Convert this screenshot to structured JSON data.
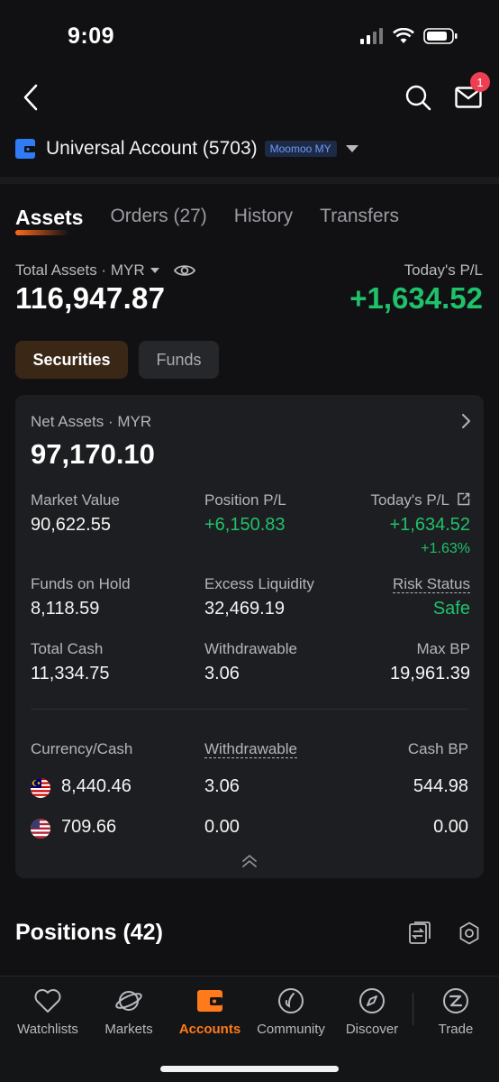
{
  "status": {
    "time": "9:09"
  },
  "nav": {
    "mail_badge": "1"
  },
  "account": {
    "name": "Universal Account (5703)",
    "broker": "Moomoo MY"
  },
  "tabs": [
    {
      "label": "Assets",
      "active": true
    },
    {
      "label": "Orders (27)",
      "active": false
    },
    {
      "label": "History",
      "active": false
    },
    {
      "label": "Transfers",
      "active": false
    }
  ],
  "totals": {
    "label": "Total Assets · MYR",
    "value": "116,947.87",
    "todays_pl_label": "Today's P/L",
    "todays_pl_value": "+1,634.52"
  },
  "segments": {
    "securities": "Securities",
    "funds": "Funds"
  },
  "card": {
    "net_assets_label": "Net Assets · MYR",
    "net_assets_value": "97,170.10",
    "market_value_label": "Market Value",
    "market_value": "90,622.55",
    "position_pl_label": "Position P/L",
    "position_pl": "+6,150.83",
    "todays_pl_label": "Today's P/L",
    "todays_pl": "+1,634.52",
    "todays_pl_pct": "+1.63%",
    "funds_on_hold_label": "Funds on Hold",
    "funds_on_hold": "8,118.59",
    "excess_liquidity_label": "Excess Liquidity",
    "excess_liquidity": "32,469.19",
    "risk_status_label": "Risk Status",
    "risk_status": "Safe",
    "total_cash_label": "Total Cash",
    "total_cash": "11,334.75",
    "withdrawable_label": "Withdrawable",
    "withdrawable": "3.06",
    "max_bp_label": "Max BP",
    "max_bp": "19,961.39",
    "currency_header": "Currency/Cash",
    "withdrawable_header": "Withdrawable",
    "cash_bp_header": "Cash BP",
    "currencies": [
      {
        "flag": "malaysia-flag",
        "cash": "8,440.46",
        "withdrawable": "3.06",
        "cash_bp": "544.98"
      },
      {
        "flag": "us-flag",
        "cash": "709.66",
        "withdrawable": "0.00",
        "cash_bp": "0.00"
      }
    ]
  },
  "positions": {
    "title": "Positions (42)"
  },
  "tabbar": [
    {
      "label": "Watchlists",
      "icon": "heart-icon",
      "active": false
    },
    {
      "label": "Markets",
      "icon": "planet-icon",
      "active": false
    },
    {
      "label": "Accounts",
      "icon": "wallet-icon",
      "active": true
    },
    {
      "label": "Community",
      "icon": "community-icon",
      "active": false
    },
    {
      "label": "Discover",
      "icon": "compass-icon",
      "active": false
    },
    {
      "label": "Trade",
      "icon": "trade-icon",
      "active": false
    }
  ],
  "colors": {
    "accent": "#ff7a1a",
    "gain": "#1fc16b",
    "background": "#111113",
    "card": "#1d1e21"
  }
}
